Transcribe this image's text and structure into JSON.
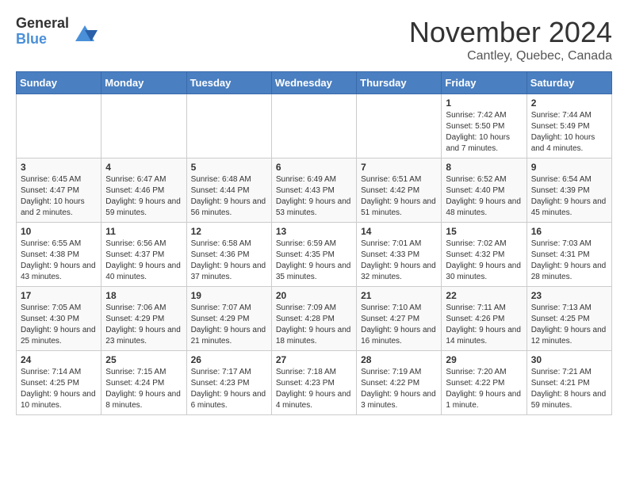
{
  "logo": {
    "general": "General",
    "blue": "Blue"
  },
  "title": "November 2024",
  "subtitle": "Cantley, Quebec, Canada",
  "days_header": [
    "Sunday",
    "Monday",
    "Tuesday",
    "Wednesday",
    "Thursday",
    "Friday",
    "Saturday"
  ],
  "weeks": [
    {
      "row_class": "row-odd",
      "days": [
        {
          "num": "",
          "empty": true
        },
        {
          "num": "",
          "empty": true
        },
        {
          "num": "",
          "empty": true
        },
        {
          "num": "",
          "empty": true
        },
        {
          "num": "",
          "empty": true
        },
        {
          "num": "1",
          "sunrise": "Sunrise: 7:42 AM",
          "sunset": "Sunset: 5:50 PM",
          "daylight": "Daylight: 10 hours and 7 minutes."
        },
        {
          "num": "2",
          "sunrise": "Sunrise: 7:44 AM",
          "sunset": "Sunset: 5:49 PM",
          "daylight": "Daylight: 10 hours and 4 minutes."
        }
      ]
    },
    {
      "row_class": "row-even",
      "days": [
        {
          "num": "3",
          "sunrise": "Sunrise: 6:45 AM",
          "sunset": "Sunset: 4:47 PM",
          "daylight": "Daylight: 10 hours and 2 minutes."
        },
        {
          "num": "4",
          "sunrise": "Sunrise: 6:47 AM",
          "sunset": "Sunset: 4:46 PM",
          "daylight": "Daylight: 9 hours and 59 minutes."
        },
        {
          "num": "5",
          "sunrise": "Sunrise: 6:48 AM",
          "sunset": "Sunset: 4:44 PM",
          "daylight": "Daylight: 9 hours and 56 minutes."
        },
        {
          "num": "6",
          "sunrise": "Sunrise: 6:49 AM",
          "sunset": "Sunset: 4:43 PM",
          "daylight": "Daylight: 9 hours and 53 minutes."
        },
        {
          "num": "7",
          "sunrise": "Sunrise: 6:51 AM",
          "sunset": "Sunset: 4:42 PM",
          "daylight": "Daylight: 9 hours and 51 minutes."
        },
        {
          "num": "8",
          "sunrise": "Sunrise: 6:52 AM",
          "sunset": "Sunset: 4:40 PM",
          "daylight": "Daylight: 9 hours and 48 minutes."
        },
        {
          "num": "9",
          "sunrise": "Sunrise: 6:54 AM",
          "sunset": "Sunset: 4:39 PM",
          "daylight": "Daylight: 9 hours and 45 minutes."
        }
      ]
    },
    {
      "row_class": "row-odd",
      "days": [
        {
          "num": "10",
          "sunrise": "Sunrise: 6:55 AM",
          "sunset": "Sunset: 4:38 PM",
          "daylight": "Daylight: 9 hours and 43 minutes."
        },
        {
          "num": "11",
          "sunrise": "Sunrise: 6:56 AM",
          "sunset": "Sunset: 4:37 PM",
          "daylight": "Daylight: 9 hours and 40 minutes."
        },
        {
          "num": "12",
          "sunrise": "Sunrise: 6:58 AM",
          "sunset": "Sunset: 4:36 PM",
          "daylight": "Daylight: 9 hours and 37 minutes."
        },
        {
          "num": "13",
          "sunrise": "Sunrise: 6:59 AM",
          "sunset": "Sunset: 4:35 PM",
          "daylight": "Daylight: 9 hours and 35 minutes."
        },
        {
          "num": "14",
          "sunrise": "Sunrise: 7:01 AM",
          "sunset": "Sunset: 4:33 PM",
          "daylight": "Daylight: 9 hours and 32 minutes."
        },
        {
          "num": "15",
          "sunrise": "Sunrise: 7:02 AM",
          "sunset": "Sunset: 4:32 PM",
          "daylight": "Daylight: 9 hours and 30 minutes."
        },
        {
          "num": "16",
          "sunrise": "Sunrise: 7:03 AM",
          "sunset": "Sunset: 4:31 PM",
          "daylight": "Daylight: 9 hours and 28 minutes."
        }
      ]
    },
    {
      "row_class": "row-even",
      "days": [
        {
          "num": "17",
          "sunrise": "Sunrise: 7:05 AM",
          "sunset": "Sunset: 4:30 PM",
          "daylight": "Daylight: 9 hours and 25 minutes."
        },
        {
          "num": "18",
          "sunrise": "Sunrise: 7:06 AM",
          "sunset": "Sunset: 4:29 PM",
          "daylight": "Daylight: 9 hours and 23 minutes."
        },
        {
          "num": "19",
          "sunrise": "Sunrise: 7:07 AM",
          "sunset": "Sunset: 4:29 PM",
          "daylight": "Daylight: 9 hours and 21 minutes."
        },
        {
          "num": "20",
          "sunrise": "Sunrise: 7:09 AM",
          "sunset": "Sunset: 4:28 PM",
          "daylight": "Daylight: 9 hours and 18 minutes."
        },
        {
          "num": "21",
          "sunrise": "Sunrise: 7:10 AM",
          "sunset": "Sunset: 4:27 PM",
          "daylight": "Daylight: 9 hours and 16 minutes."
        },
        {
          "num": "22",
          "sunrise": "Sunrise: 7:11 AM",
          "sunset": "Sunset: 4:26 PM",
          "daylight": "Daylight: 9 hours and 14 minutes."
        },
        {
          "num": "23",
          "sunrise": "Sunrise: 7:13 AM",
          "sunset": "Sunset: 4:25 PM",
          "daylight": "Daylight: 9 hours and 12 minutes."
        }
      ]
    },
    {
      "row_class": "row-odd",
      "days": [
        {
          "num": "24",
          "sunrise": "Sunrise: 7:14 AM",
          "sunset": "Sunset: 4:25 PM",
          "daylight": "Daylight: 9 hours and 10 minutes."
        },
        {
          "num": "25",
          "sunrise": "Sunrise: 7:15 AM",
          "sunset": "Sunset: 4:24 PM",
          "daylight": "Daylight: 9 hours and 8 minutes."
        },
        {
          "num": "26",
          "sunrise": "Sunrise: 7:17 AM",
          "sunset": "Sunset: 4:23 PM",
          "daylight": "Daylight: 9 hours and 6 minutes."
        },
        {
          "num": "27",
          "sunrise": "Sunrise: 7:18 AM",
          "sunset": "Sunset: 4:23 PM",
          "daylight": "Daylight: 9 hours and 4 minutes."
        },
        {
          "num": "28",
          "sunrise": "Sunrise: 7:19 AM",
          "sunset": "Sunset: 4:22 PM",
          "daylight": "Daylight: 9 hours and 3 minutes."
        },
        {
          "num": "29",
          "sunrise": "Sunrise: 7:20 AM",
          "sunset": "Sunset: 4:22 PM",
          "daylight": "Daylight: 9 hours and 1 minute."
        },
        {
          "num": "30",
          "sunrise": "Sunrise: 7:21 AM",
          "sunset": "Sunset: 4:21 PM",
          "daylight": "Daylight: 8 hours and 59 minutes."
        }
      ]
    }
  ]
}
